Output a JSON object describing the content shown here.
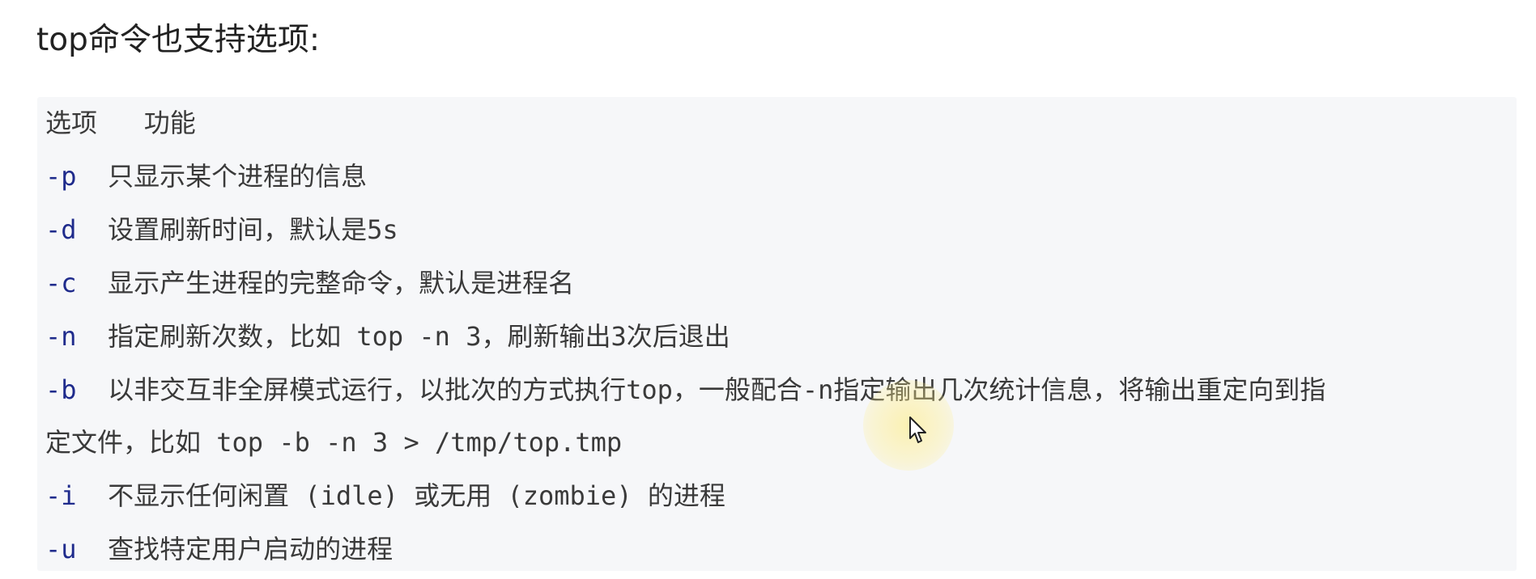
{
  "heading": "top命令也支持选项:",
  "table": {
    "header": "选项   功能",
    "rows": [
      {
        "flag": "-p",
        "text": "  只显示某个进程的信息"
      },
      {
        "flag": "-d",
        "text": "  设置刷新时间，默认是5s"
      },
      {
        "flag": "-c",
        "text": "  显示产生进程的完整命令，默认是进程名"
      },
      {
        "flag": "-n",
        "text": "  指定刷新次数，比如 top -n 3，刷新输出3次后退出"
      },
      {
        "flag": "-b",
        "text": "  以非交互非全屏模式运行，以批次的方式执行top，一般配合-n指定输出几次统计信息，将输出重定向到指"
      },
      {
        "flag": "",
        "text": "定文件，比如 top -b -n 3 > /tmp/top.tmp"
      },
      {
        "flag": "-i",
        "text": "  不显示任何闲置 (idle) 或无用 (zombie) 的进程"
      },
      {
        "flag": "-u",
        "text": "  查找特定用户启动的进程"
      }
    ]
  },
  "colors": {
    "flag": "#1f2b8c",
    "code_background": "#f6f7f9",
    "cursor_highlight": "#fff1a0"
  },
  "icons": {
    "cursor": "mouse-pointer-icon"
  }
}
